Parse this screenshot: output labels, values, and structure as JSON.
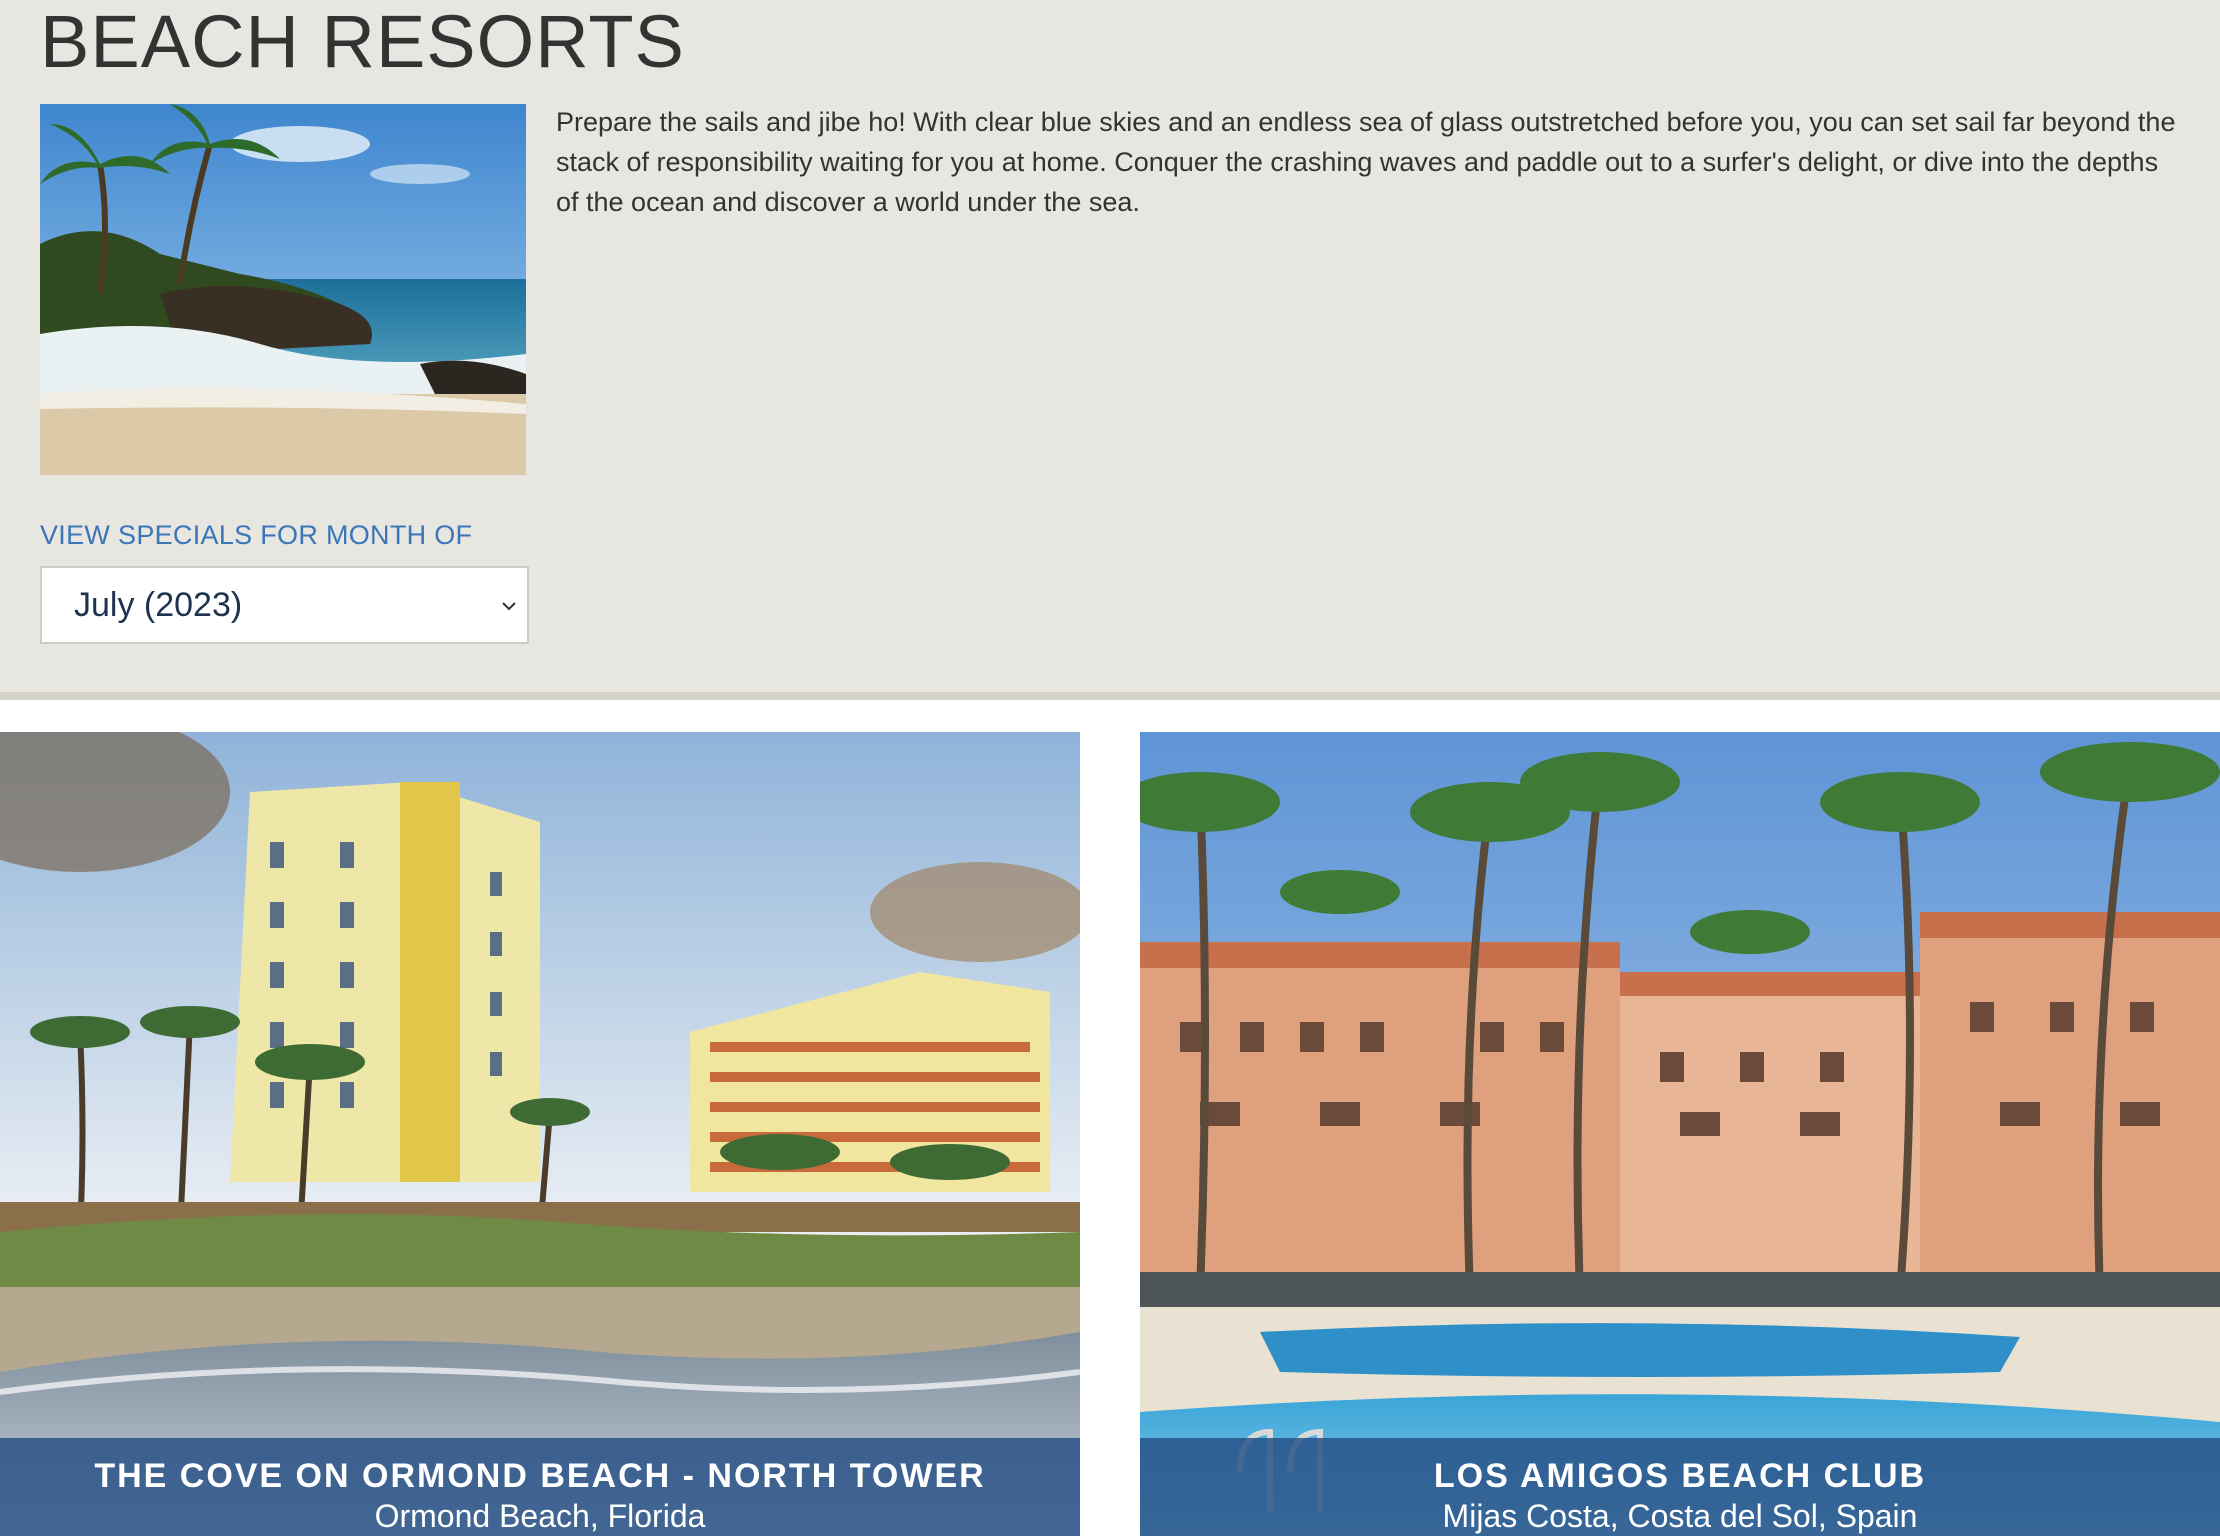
{
  "page": {
    "title": "BEACH RESORTS",
    "intro": "Prepare the sails and jibe ho! With clear blue skies and an endless sea of glass outstretched before you, you can set sail far beyond the stack of responsibility waiting for you at home. Conquer the crashing waves and paddle out to a surfer's delight, or dive into the depths of the ocean and discover a world under the sea."
  },
  "specials": {
    "label": "VIEW SPECIALS FOR MONTH OF",
    "selected_month": "July (2023)"
  },
  "resorts": [
    {
      "name": "THE COVE ON ORMOND BEACH - NORTH TOWER",
      "location": "Ormond Beach, Florida"
    },
    {
      "name": "LOS AMIGOS BEACH CLUB",
      "location": "Mijas Costa, Costa del Sol, Spain"
    }
  ],
  "colors": {
    "header_background": "#e8e6e0",
    "link_blue": "#3a76b8",
    "caption_overlay": "#244e84"
  }
}
